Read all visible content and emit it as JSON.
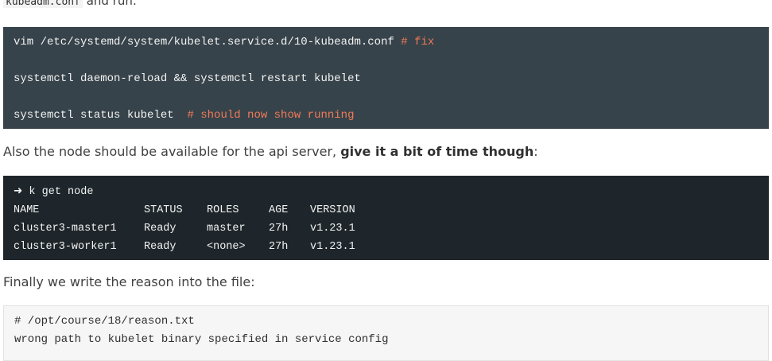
{
  "intro": {
    "code": "kubeadm.conf",
    "text": " and run:"
  },
  "block1": {
    "line1_cmd": "vim /etc/systemd/system/kubelet.service.d/10-kubeadm.conf ",
    "line1_comment": "# fix",
    "line2_cmd": "systemctl daemon-reload && systemctl restart kubelet",
    "line3_cmd": "systemctl status kubelet  ",
    "line3_comment": "# should now show running"
  },
  "para1": {
    "text": "Also the node should be available for the api server, ",
    "bold": "give it a bit of time though",
    "tail": ":"
  },
  "block2": {
    "prompt": "➜ k get node",
    "headers": [
      "NAME",
      "STATUS",
      "ROLES",
      "AGE",
      "VERSION"
    ],
    "rows": [
      [
        "cluster3-master1",
        "Ready",
        "master",
        "27h",
        "v1.23.1"
      ],
      [
        "cluster3-worker1",
        "Ready",
        "<none>",
        "27h",
        "v1.23.1"
      ]
    ]
  },
  "para2": {
    "text": "Finally we write the reason into the file:"
  },
  "block3": {
    "line1": "# /opt/course/18/reason.txt",
    "line2": "wrong path to kubelet binary specified in service config"
  }
}
